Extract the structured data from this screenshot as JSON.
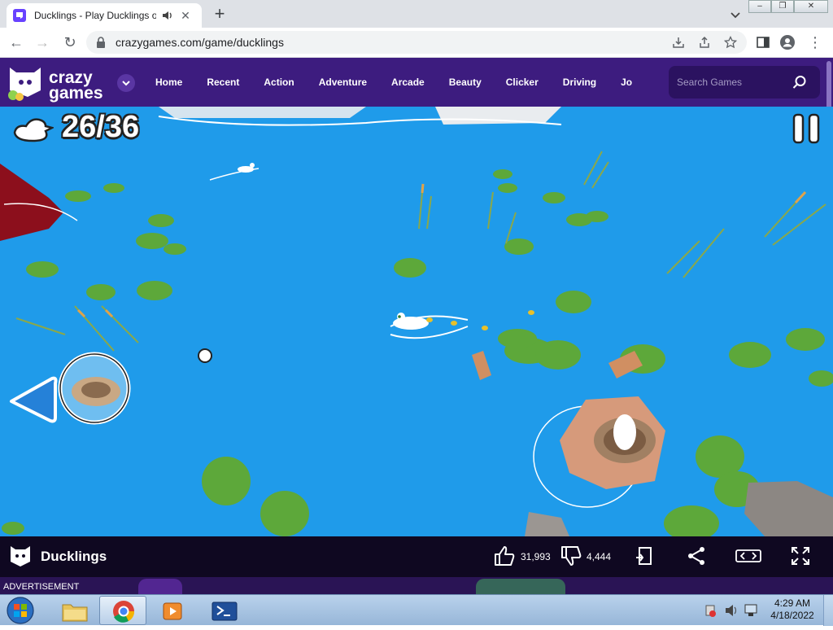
{
  "browser": {
    "tab_title": "Ducklings - Play Ducklings o",
    "url": "crazygames.com/game/ducklings"
  },
  "site": {
    "logo_text_1": "crazy",
    "logo_text_2": "games",
    "nav": [
      "Home",
      "Recent",
      "Action",
      "Adventure",
      "Arcade",
      "Beauty",
      "Clicker",
      "Driving",
      "Jo"
    ],
    "search_placeholder": "Search Games",
    "brand_color": "#3d1c7f"
  },
  "game": {
    "score": "26/36",
    "water_color": "#1f9bea"
  },
  "gamebar": {
    "title": "Ducklings",
    "likes": "31,993",
    "dislikes": "4,444"
  },
  "ad": {
    "label": "ADVERTISEMENT"
  },
  "taskbar": {
    "time": "4:29 AM",
    "date": "4/18/2022",
    "apps": [
      "windows-explorer",
      "google-chrome",
      "media-player",
      "powershell"
    ]
  }
}
